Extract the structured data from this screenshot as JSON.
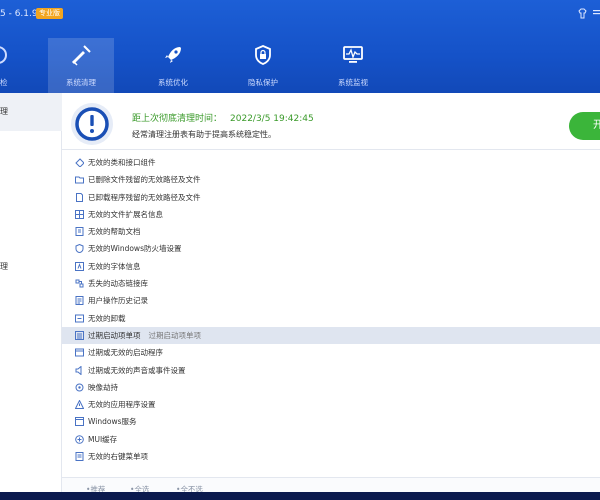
{
  "window": {
    "version_text": "5 - 6.1.9",
    "badge": "专业版"
  },
  "nav": {
    "partial_label": "检",
    "tabs": [
      {
        "label": "系统清理",
        "icon": "broom-icon"
      },
      {
        "label": "系统优化",
        "icon": "rocket-icon"
      },
      {
        "label": "隐私保护",
        "icon": "lock-shield-icon"
      },
      {
        "label": "系统监视",
        "icon": "monitor-icon"
      }
    ]
  },
  "sidebar": {
    "items": [
      {
        "label": "理"
      },
      {
        "label": "理"
      }
    ]
  },
  "status": {
    "last_clean_label": "距上次彻底清理时间：",
    "last_clean_value": "2022/3/5 19:42:45",
    "advice": "经常清理注册表有助于提高系统稳定性。",
    "start_button": "开"
  },
  "items": [
    {
      "label": "无效的类和接口组件",
      "icon": "component-icon"
    },
    {
      "label": "已删除文件残留的无效路径及文件",
      "icon": "folder-icon"
    },
    {
      "label": "已卸载程序残留的无效路径及文件",
      "icon": "file-icon"
    },
    {
      "label": "无效的文件扩展名信息",
      "icon": "grid-icon"
    },
    {
      "label": "无效的帮助文档",
      "icon": "help-doc-icon"
    },
    {
      "label": "无效的Windows防火墙设置",
      "icon": "shield-icon"
    },
    {
      "label": "无效的字体信息",
      "icon": "font-icon"
    },
    {
      "label": "丢失的动态链接库",
      "icon": "dll-icon"
    },
    {
      "label": "用户操作历史记录",
      "icon": "history-icon"
    },
    {
      "label": "无效的卸载",
      "icon": "uninstall-icon"
    },
    {
      "label": "过期启动项单项",
      "sub": "过期启动项单项",
      "icon": "startup-icon",
      "selected": true
    },
    {
      "label": "过期或无效的启动程序",
      "icon": "program-icon"
    },
    {
      "label": "过期或无效的声音或事件设置",
      "icon": "sound-icon"
    },
    {
      "label": "映像劫持",
      "icon": "image-hijack-icon"
    },
    {
      "label": "无效的应用程序设置",
      "icon": "warning-icon"
    },
    {
      "label": "Windows服务",
      "icon": "window-icon"
    },
    {
      "label": "MUI缓存",
      "icon": "cache-icon"
    },
    {
      "label": "无效的右键菜单项",
      "icon": "context-menu-icon"
    }
  ],
  "footer": {
    "links": [
      "推荐",
      "全选",
      "全不选"
    ]
  }
}
